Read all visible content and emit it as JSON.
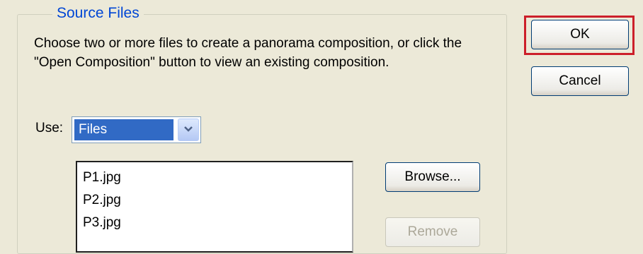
{
  "dialog": {
    "group_title": "Source Files",
    "description": "Choose two or more files to create a panorama composition, or click the \"Open Composition\" button to view an existing composition.",
    "use_label": "Use:",
    "use_selected": "Files",
    "files": [
      "P1.jpg",
      "P2.jpg",
      "P3.jpg"
    ],
    "buttons": {
      "ok": "OK",
      "cancel": "Cancel",
      "browse": "Browse...",
      "remove": "Remove"
    }
  },
  "colors": {
    "legend": "#0046d5",
    "selection": "#316ac5",
    "focus_outline": "#cc1f2a",
    "dialog_bg": "#ece9d8"
  },
  "icons": {
    "dropdown": "chevron-down-icon"
  }
}
